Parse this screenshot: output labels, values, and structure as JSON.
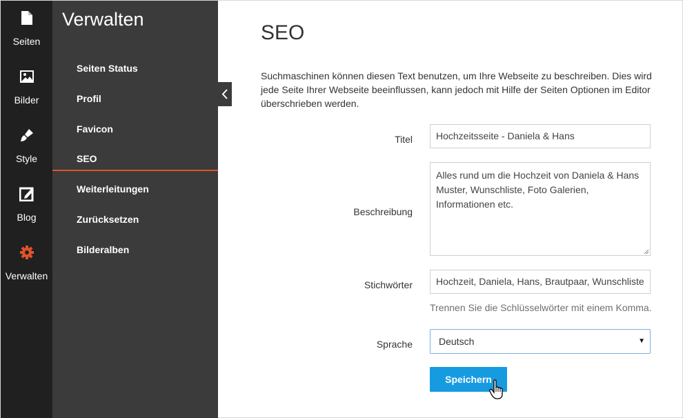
{
  "rail": {
    "items": [
      {
        "label": "Seiten",
        "icon": "page-icon"
      },
      {
        "label": "Bilder",
        "icon": "image-icon"
      },
      {
        "label": "Style",
        "icon": "brush-icon"
      },
      {
        "label": "Blog",
        "icon": "edit-icon"
      },
      {
        "label": "Verwalten",
        "icon": "gear-icon"
      }
    ],
    "active_color": "#e0532a"
  },
  "panel": {
    "title": "Verwalten",
    "items": [
      {
        "label": "Seiten Status"
      },
      {
        "label": "Profil"
      },
      {
        "label": "Favicon"
      },
      {
        "label": "SEO",
        "active": true
      },
      {
        "label": "Weiterleitungen"
      },
      {
        "label": "Zurücksetzen"
      },
      {
        "label": "Bilderalben"
      }
    ]
  },
  "main": {
    "title": "SEO",
    "intro": "Suchmaschinen können diesen Text benutzen, um Ihre Webseite zu beschreiben. Dies wird jede Seite Ihrer Webseite beeinflussen, kann jedoch mit Hilfe der Seiten Optionen im Editor überschrieben werden.",
    "form": {
      "title_label": "Titel",
      "title_value": "Hochzeitsseite - Daniela & Hans",
      "description_label": "Beschreibung",
      "description_value": "Alles rund um die Hochzeit von Daniela & Hans Muster, Wunschliste, Foto Galerien, Informationen etc.",
      "keywords_label": "Stichwörter",
      "keywords_value": "Hochzeit, Daniela, Hans, Brautpaar, Wunschliste",
      "keywords_hint": "Trennen Sie die Schlüsselwörter mit einem Komma.",
      "language_label": "Sprache",
      "language_value": "Deutsch",
      "save_label": "Speichern"
    }
  },
  "colors": {
    "accent": "#e0532a",
    "primary_button": "#179be0",
    "rail_bg": "#202020",
    "panel_bg": "#3b3b3b"
  }
}
